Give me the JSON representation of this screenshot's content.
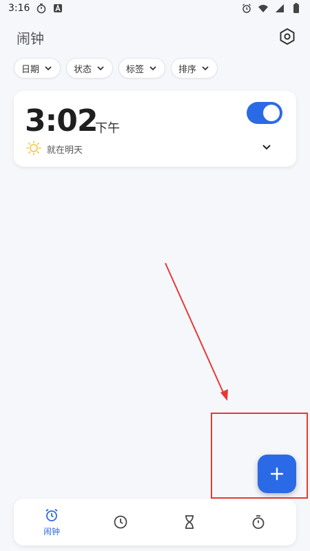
{
  "status_bar": {
    "time": "3:16",
    "icons_left": [
      "timer-icon",
      "a-icon"
    ],
    "icons_right": [
      "alarm-icon",
      "wifi-icon",
      "signal-icon",
      "battery-icon"
    ]
  },
  "header": {
    "title": "闹钟",
    "settings_icon": "settings-icon"
  },
  "filters": [
    {
      "label": "日期"
    },
    {
      "label": "状态"
    },
    {
      "label": "标签"
    },
    {
      "label": "排序"
    }
  ],
  "alarm": {
    "time": "3:02",
    "ampm": "下午",
    "enabled": true,
    "schedule": "就在明天",
    "weather_icon": "sun-icon"
  },
  "fab": {
    "icon": "plus-icon"
  },
  "bottom_nav": {
    "items": [
      {
        "icon": "alarm-icon",
        "label": "闹钟",
        "active": true
      },
      {
        "icon": "clock-icon",
        "label": "",
        "active": false
      },
      {
        "icon": "hourglass-icon",
        "label": "",
        "active": false
      },
      {
        "icon": "stopwatch-icon",
        "label": "",
        "active": false
      }
    ]
  },
  "colors": {
    "accent": "#2b6ae6",
    "annotation": "#e53935",
    "background": "#f6f7fb"
  }
}
